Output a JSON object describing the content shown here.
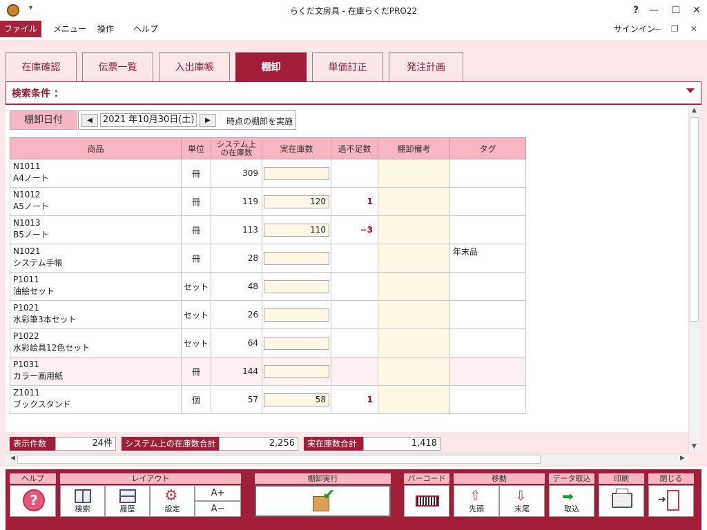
{
  "window": {
    "title": "らくだ文房具 - 在庫らくだPRO22",
    "help_mark": "?",
    "minimize": "—",
    "maximize": "☐",
    "close": "✕"
  },
  "menu": {
    "file": "ファイル",
    "items": [
      "メニュー",
      "操作",
      "ヘルプ"
    ],
    "signin": "サインイン"
  },
  "tabs": [
    {
      "label": "在庫確認",
      "active": false
    },
    {
      "label": "伝票一覧",
      "active": false
    },
    {
      "label": "入出庫帳",
      "active": false
    },
    {
      "label": "棚卸",
      "active": true
    },
    {
      "label": "単価訂正",
      "active": false
    },
    {
      "label": "発注計画",
      "active": false
    }
  ],
  "criteria": {
    "label": "検索条件 ："
  },
  "date_row": {
    "label": "棚卸日付",
    "prev": "◀",
    "next": "▶",
    "value": "2021 年10月30日(土)",
    "suffix": "時点の棚卸を実施"
  },
  "table": {
    "headers": {
      "product": "商品",
      "unit": "単位",
      "system_stock_1": "システム上",
      "system_stock_2": "の在庫数",
      "actual": "実在庫数",
      "diff": "過不足数",
      "memo": "棚卸備考",
      "tag": "タグ"
    },
    "rows": [
      {
        "code": "N1011",
        "name": "A4ノート",
        "unit": "冊",
        "system": "309",
        "actual": "",
        "diff": "",
        "tag": ""
      },
      {
        "code": "N1012",
        "name": "A5ノート",
        "unit": "冊",
        "system": "119",
        "actual": "120",
        "diff": "1",
        "tag": ""
      },
      {
        "code": "N1013",
        "name": "B5ノート",
        "unit": "冊",
        "system": "113",
        "actual": "110",
        "diff": "−3",
        "tag": ""
      },
      {
        "code": "N1021",
        "name": "システム手帳",
        "unit": "冊",
        "system": "28",
        "actual": "",
        "diff": "",
        "tag": "年末品"
      },
      {
        "code": "P1011",
        "name": "油絵セット",
        "unit": "セット",
        "system": "48",
        "actual": "",
        "diff": "",
        "tag": ""
      },
      {
        "code": "P1021",
        "name": "水彩筆3本セット",
        "unit": "セット",
        "system": "26",
        "actual": "",
        "diff": "",
        "tag": ""
      },
      {
        "code": "P1022",
        "name": "水彩絵具12色セット",
        "unit": "セット",
        "system": "64",
        "actual": "",
        "diff": "",
        "tag": ""
      },
      {
        "code": "P1031",
        "name": "カラー画用紙",
        "unit": "冊",
        "system": "144",
        "actual": "",
        "diff": "",
        "tag": "",
        "selected": true
      },
      {
        "code": "Z1011",
        "name": "ブックスタンド",
        "unit": "個",
        "system": "57",
        "actual": "58",
        "diff": "1",
        "tag": ""
      }
    ]
  },
  "summary": {
    "count_label": "表示件数",
    "count_value": "24件",
    "system_total_label": "システム上の在庫数合計",
    "system_total_value": "2,256",
    "actual_total_label": "実在庫数合計",
    "actual_total_value": "1,418"
  },
  "toolbar": {
    "help_group": "ヘルプ",
    "help_icon": "?",
    "layout_group": "レイアウト",
    "search": "検索",
    "history": "履歴",
    "settings": "設定",
    "font_up": "A+",
    "font_down": "A−",
    "execute_group": "棚卸実行",
    "barcode_group": "バーコード",
    "move_group": "移動",
    "first": "先頭",
    "last": "末尾",
    "import_group": "データ取込",
    "import": "取込",
    "print_group": "印刷",
    "close_group": "閉じる"
  },
  "colors": {
    "accent": "#a11e3a",
    "pink": "#f7b6c2",
    "frame": "#fbe6ea",
    "input_bg": "#fdf8e6",
    "negative": "#c0001c"
  }
}
